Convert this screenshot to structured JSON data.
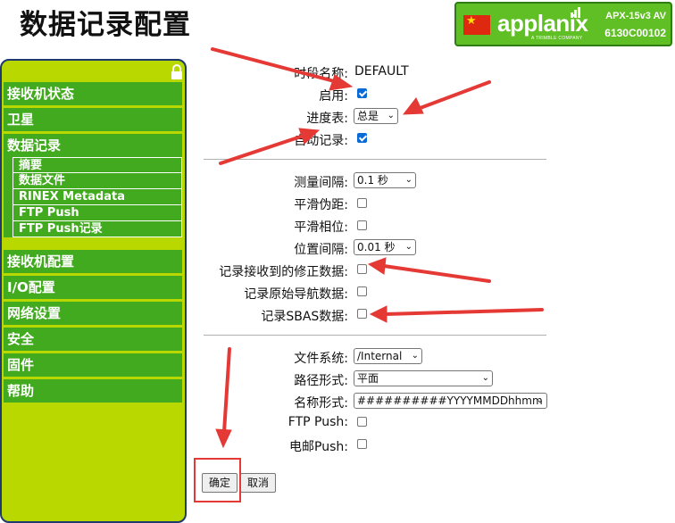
{
  "page": {
    "title": "数据记录配置"
  },
  "logo": {
    "brand": "applanix",
    "tagline": "A TRIMBLE COMPANY",
    "model": "APX-15v3 AV",
    "serial": "6130C00102",
    "flag": "china-flag",
    "color": "#5fbf24"
  },
  "sidebar": {
    "items": [
      {
        "label": "接收机状态"
      },
      {
        "label": "卫星"
      },
      {
        "label": "数据记录",
        "sub": [
          "摘要",
          "数据文件",
          "RINEX Metadata",
          "FTP Push",
          "FTP Push记录"
        ]
      },
      {
        "label": "接收机配置"
      },
      {
        "label": "I/O配置"
      },
      {
        "label": "网络设置"
      },
      {
        "label": "安全"
      },
      {
        "label": "固件"
      },
      {
        "label": "帮助"
      }
    ],
    "bg_color": "#b8d800",
    "item_color": "#42aa1e",
    "lock_icon": "lock-icon"
  },
  "form": {
    "session_name": {
      "label": "时段名称:",
      "value": "DEFAULT"
    },
    "enable": {
      "label": "启用:",
      "checked": true
    },
    "schedule": {
      "label": "进度表:",
      "value": "总是"
    },
    "auto_record": {
      "label": "自动记录:",
      "checked": true
    },
    "measure_interval": {
      "label": "测量间隔:",
      "value": "0.1 秒"
    },
    "smooth_pseudorange": {
      "label": "平滑伪距:",
      "checked": false
    },
    "smooth_phase": {
      "label": "平滑相位:",
      "checked": false
    },
    "position_interval": {
      "label": "位置间隔:",
      "value": "0.01 秒"
    },
    "record_corrections": {
      "label": "记录接收到的修正数据:",
      "checked": false
    },
    "record_nav": {
      "label": "记录原始导航数据:",
      "checked": false
    },
    "record_sbas": {
      "label": "记录SBAS数据:",
      "checked": false
    },
    "file_system": {
      "label": "文件系统:",
      "value": "/Internal"
    },
    "path_style": {
      "label": "路径形式:",
      "value": "平面"
    },
    "name_style": {
      "label": "名称形式:",
      "value": "##########YYYYMMDDhhmm"
    },
    "ftp_push": {
      "label": "FTP Push:",
      "checked": false
    },
    "email_push": {
      "label": "电邮Push:",
      "checked": false
    }
  },
  "buttons": {
    "ok": "确定",
    "cancel": "取消"
  },
  "annotation_color": "#e53935"
}
